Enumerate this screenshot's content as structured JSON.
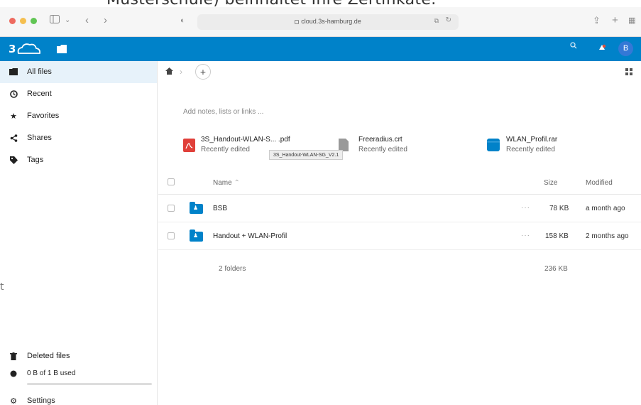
{
  "caption": {
    "top_text": "Musterschule) beinhaltet Ihre Zertifikate.",
    "left_text": "t"
  },
  "browser": {
    "url": "cloud.3s-hamburg.de"
  },
  "header": {
    "avatar_letter": "B"
  },
  "sidebar": {
    "items": [
      {
        "label": "All files",
        "icon": "folder-icon"
      },
      {
        "label": "Recent",
        "icon": "clock-icon"
      },
      {
        "label": "Favorites",
        "icon": "star-icon"
      },
      {
        "label": "Shares",
        "icon": "share-icon"
      },
      {
        "label": "Tags",
        "icon": "tag-icon"
      }
    ],
    "deleted": "Deleted files",
    "quota": "0 B of 1 B used",
    "settings": "Settings"
  },
  "main": {
    "notes_placeholder": "Add notes, lists or links ...",
    "recent": [
      {
        "name": "3S_Handout-WLAN-S... .pdf",
        "status": "Recently edited",
        "icon": "pdf-icon"
      },
      {
        "name": "Freeradius.crt",
        "status": "Recently edited",
        "icon": "file-icon"
      },
      {
        "name": "WLAN_Profil.rar",
        "status": "Recently edited",
        "icon": "archive-icon"
      }
    ],
    "tooltip": "3S_Handout-WLAN-SG_V2.1",
    "columns": {
      "name": "Name",
      "size": "Size",
      "modified": "Modified"
    },
    "rows": [
      {
        "name": "BSB",
        "size": "78 KB",
        "modified": "a month ago"
      },
      {
        "name": "Handout + WLAN-Profil",
        "size": "158 KB",
        "modified": "2 months ago"
      }
    ],
    "summary": {
      "count": "2 folders",
      "size": "236 KB"
    }
  },
  "colors": {
    "accent": "#0082c9",
    "active_bg": "#e7f2fa"
  }
}
